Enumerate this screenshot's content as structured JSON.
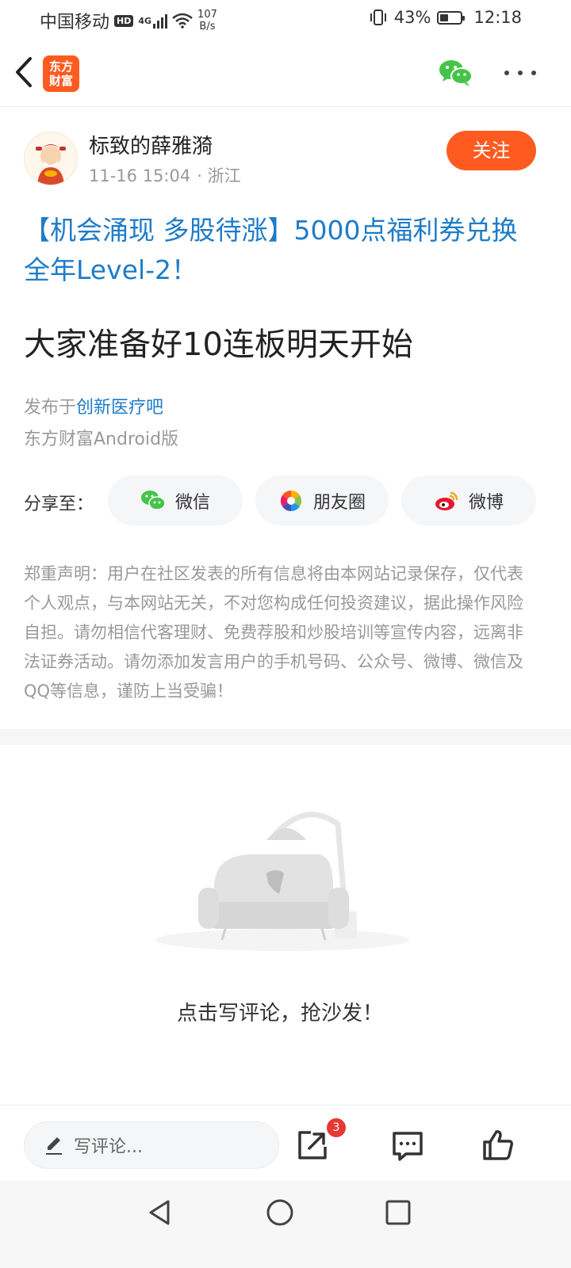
{
  "status_bar": {
    "carrier": "中国移动",
    "hd": "HD",
    "network": "4G",
    "speed_value": "107",
    "speed_unit": "B/s",
    "battery": "43%",
    "battery_level": 0.43,
    "time": "12:18"
  },
  "nav": {
    "app_logo_line1": "东方",
    "app_logo_line2": "财富"
  },
  "author": {
    "name": "标致的薛雅漪",
    "datetime": "11-16 15:04",
    "location": "· 浙江",
    "follow_label": "关注"
  },
  "post": {
    "promo_link": "【机会涌现 多股待涨】5000点福利券兑换全年Level-2！",
    "title": "大家准备好10连板明天开始",
    "published_prefix": "发布于",
    "published_bar": "创新医疗吧",
    "client": "东方财富Android版"
  },
  "share": {
    "label": "分享至：",
    "wechat": "微信",
    "moments": "朋友圈",
    "weibo": "微博"
  },
  "disclaimer": "郑重声明：用户在社区发表的所有信息将由本网站记录保存，仅代表个人观点，与本网站无关，不对您构成任何投资建议，据此操作风险自担。请勿相信代客理财、免费荐股和炒股培训等宣传内容，远离非法证券活动。请勿添加发言用户的手机号码、公众号、微博、微信及QQ等信息，谨防上当受骗！",
  "comments": {
    "empty_text": "点击写评论，抢沙发！"
  },
  "bottom_bar": {
    "input_placeholder": "写评论...",
    "share_badge": "3"
  },
  "colors": {
    "accent": "#ff5a1f",
    "link": "#1e7cc8",
    "wechat": "#44c449",
    "badge": "#e53935"
  }
}
